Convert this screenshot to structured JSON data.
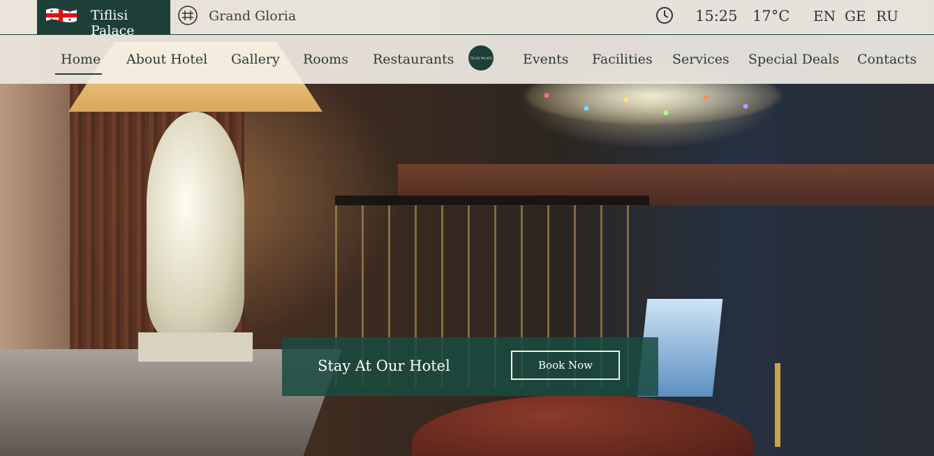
{
  "brand": {
    "name": "Tiflisi Palace",
    "sister_hotel": "Grand Gloria",
    "accent_color": "#1d3f37"
  },
  "topbar": {
    "time": "15:25",
    "temperature": "17°C",
    "languages": [
      "EN",
      "GE",
      "RU"
    ]
  },
  "nav": {
    "items": [
      {
        "label": "Home",
        "active": true
      },
      {
        "label": "About Hotel"
      },
      {
        "label": "Gallery"
      },
      {
        "label": "Rooms"
      },
      {
        "label": "Restaurants"
      },
      {
        "label": "Events"
      },
      {
        "label": "Facilities"
      },
      {
        "label": "Services"
      },
      {
        "label": "Special Deals"
      },
      {
        "label": "Contacts"
      }
    ],
    "logo_text": "TIFLISI PALACE"
  },
  "booking": {
    "title": "Stay At Our Hotel",
    "button_label": "Book Now"
  }
}
